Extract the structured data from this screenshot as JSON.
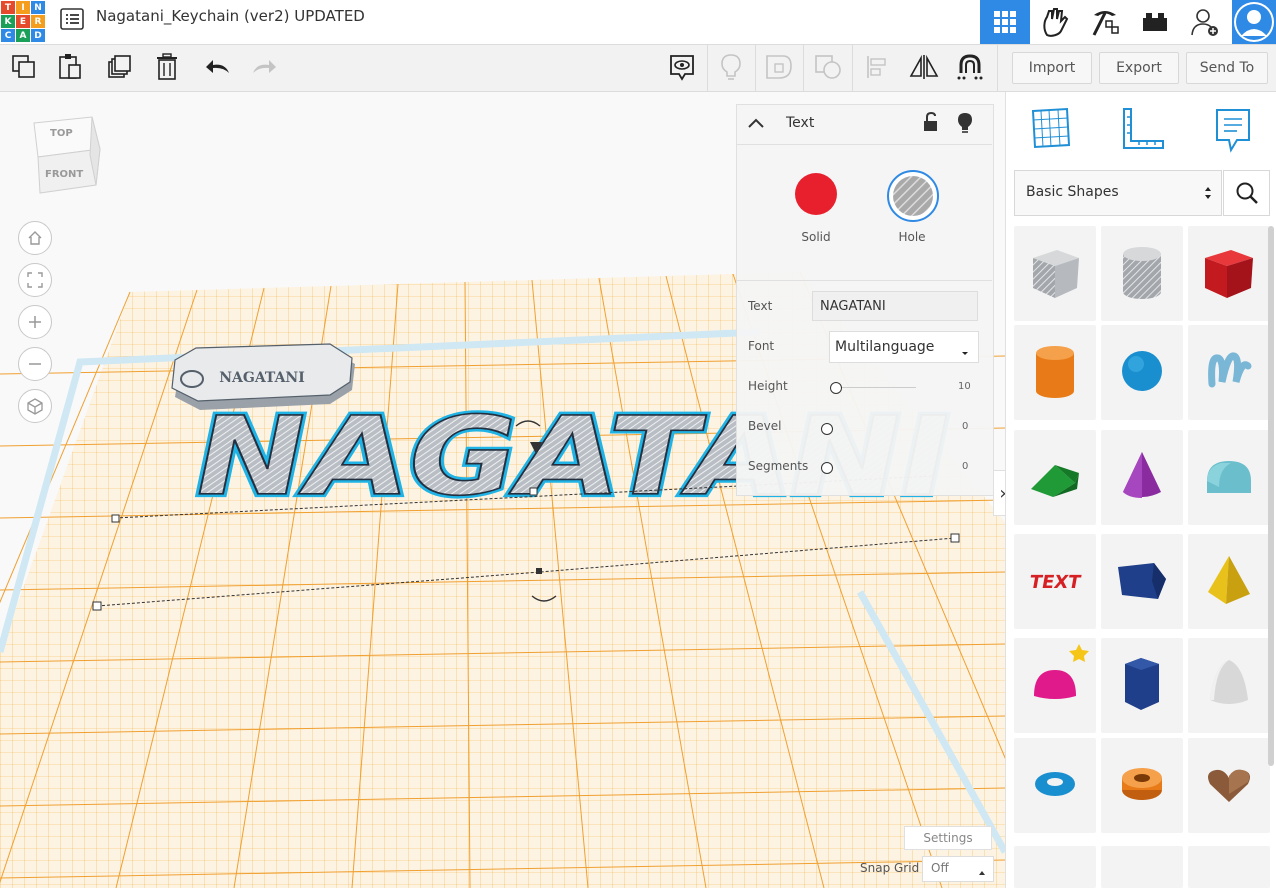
{
  "app": {
    "logo_letters": [
      "T",
      "I",
      "N",
      "K",
      "E",
      "R",
      "C",
      "A",
      "D"
    ],
    "logo_colors": [
      "#e54a2c",
      "#f59d1c",
      "#2f8ae5",
      "#1ba05a",
      "#e54a2c",
      "#f59d1c",
      "#2f8ae5",
      "#1ba05a",
      "#2f8ae5"
    ],
    "doc_title": "Nagatani_Keychain (ver2) UPDATED"
  },
  "header": {
    "right_icons": [
      "grid-view-icon",
      "hand-blocks-icon",
      "pickaxe-icon",
      "brick-icon",
      "add-user-icon",
      "avatar"
    ]
  },
  "toolbar": {
    "left_icons": [
      "copy-icon",
      "paste-icon",
      "duplicate-icon",
      "delete-icon",
      "undo-icon",
      "redo-icon"
    ],
    "center_icons": [
      "note-icon",
      "lightbulb-icon",
      "group-icon",
      "ungroup-icon",
      "align-icon",
      "mirror-icon",
      "magnet-icon"
    ],
    "import_label": "Import",
    "export_label": "Export",
    "sendto_label": "Send To"
  },
  "viewcube": {
    "top_label": "TOP",
    "front_label": "FRONT"
  },
  "view_controls": [
    "home-icon",
    "fit-icon",
    "zoom-in-icon",
    "zoom-out-icon",
    "ortho-icon"
  ],
  "canvas_text": {
    "main_text": "NAGATANI",
    "tag_text": "NAGATANI"
  },
  "inspector": {
    "title": "Text",
    "solid_label": "Solid",
    "hole_label": "Hole",
    "solid_color": "#e8202e",
    "fields": {
      "text_label": "Text",
      "text_value": "NAGATANI",
      "font_label": "Font",
      "font_value": "Multilanguage",
      "height_label": "Height",
      "height_value": "10",
      "bevel_label": "Bevel",
      "bevel_value": "0",
      "segments_label": "Segments",
      "segments_value": "0"
    }
  },
  "sidebar": {
    "top_icons": [
      "workplane-icon",
      "ruler-icon",
      "notes-icon"
    ],
    "category": "Basic Shapes",
    "shapes": [
      "box-hole",
      "cylinder-hole",
      "box",
      "cylinder",
      "sphere",
      "scribble",
      "roof",
      "cone",
      "round-roof",
      "text",
      "polygon",
      "pyramid",
      "half-sphere",
      "hexagon",
      "paraboloid",
      "torus",
      "tube",
      "heart"
    ]
  },
  "bottom": {
    "settings_label": "Settings",
    "snap_label": "Snap Grid",
    "snap_value": "Off"
  },
  "colors": {
    "accent": "#2f8ae5",
    "grid_orange": "#f5a623",
    "selection_cyan": "#1fb3e6"
  }
}
